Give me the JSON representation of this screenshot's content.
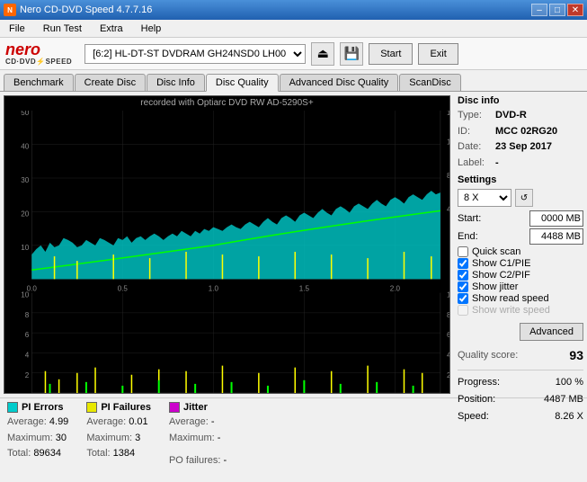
{
  "titleBar": {
    "title": "Nero CD-DVD Speed 4.7.7.16",
    "minBtn": "–",
    "maxBtn": "□",
    "closeBtn": "✕"
  },
  "menuBar": {
    "items": [
      "File",
      "Run Test",
      "Extra",
      "Help"
    ]
  },
  "toolbar": {
    "driveLabel": "[6:2]  HL-DT-ST DVDRAM GH24NSD0 LH00",
    "startBtn": "Start",
    "exitBtn": "Exit"
  },
  "tabs": [
    {
      "label": "Benchmark",
      "active": false
    },
    {
      "label": "Create Disc",
      "active": false
    },
    {
      "label": "Disc Info",
      "active": false
    },
    {
      "label": "Disc Quality",
      "active": true
    },
    {
      "label": "Advanced Disc Quality",
      "active": false
    },
    {
      "label": "ScanDisc",
      "active": false
    }
  ],
  "chartTitle": "recorded with Optiarc  DVD RW AD-5290S+",
  "discInfo": {
    "title": "Disc info",
    "typeLabel": "Type:",
    "typeValue": "DVD-R",
    "idLabel": "ID:",
    "idValue": "MCC 02RG20",
    "dateLabel": "Date:",
    "dateValue": "23 Sep 2017",
    "labelLabel": "Label:",
    "labelValue": "-"
  },
  "settings": {
    "title": "Settings",
    "speed": "8 X",
    "startLabel": "Start:",
    "startValue": "0000 MB",
    "endLabel": "End:",
    "endValue": "4488 MB",
    "checkboxes": [
      {
        "id": "quickscan",
        "label": "Quick scan",
        "checked": false
      },
      {
        "id": "c1pie",
        "label": "Show C1/PIE",
        "checked": true
      },
      {
        "id": "c2pif",
        "label": "Show C2/PIF",
        "checked": true
      },
      {
        "id": "jitter",
        "label": "Show jitter",
        "checked": true
      },
      {
        "id": "readspeed",
        "label": "Show read speed",
        "checked": true
      },
      {
        "id": "writespeed",
        "label": "Show write speed",
        "checked": false
      }
    ],
    "advancedBtn": "Advanced"
  },
  "qualityScore": {
    "label": "Quality score:",
    "value": "93"
  },
  "progress": {
    "progressLabel": "Progress:",
    "progressValue": "100 %",
    "positionLabel": "Position:",
    "positionValue": "4487 MB",
    "speedLabel": "Speed:",
    "speedValue": "8.26 X"
  },
  "stats": {
    "piErrors": {
      "colorBox": "#00e0e0",
      "title": "PI Errors",
      "avgLabel": "Average:",
      "avgValue": "4.99",
      "maxLabel": "Maximum:",
      "maxValue": "30",
      "totalLabel": "Total:",
      "totalValue": "89634"
    },
    "piFailures": {
      "colorBox": "#e0e000",
      "title": "PI Failures",
      "avgLabel": "Average:",
      "avgValue": "0.01",
      "maxLabel": "Maximum:",
      "maxValue": "3",
      "totalLabel": "Total:",
      "totalValue": "1384"
    },
    "jitter": {
      "colorBox": "#e000e0",
      "title": "Jitter",
      "avgLabel": "Average:",
      "avgValue": "-",
      "maxLabel": "Maximum:",
      "maxValue": "-"
    },
    "poFailures": {
      "label": "PO failures:",
      "value": "-"
    }
  },
  "icons": {
    "eject": "⏏",
    "save": "💾",
    "refresh": "🔄"
  }
}
